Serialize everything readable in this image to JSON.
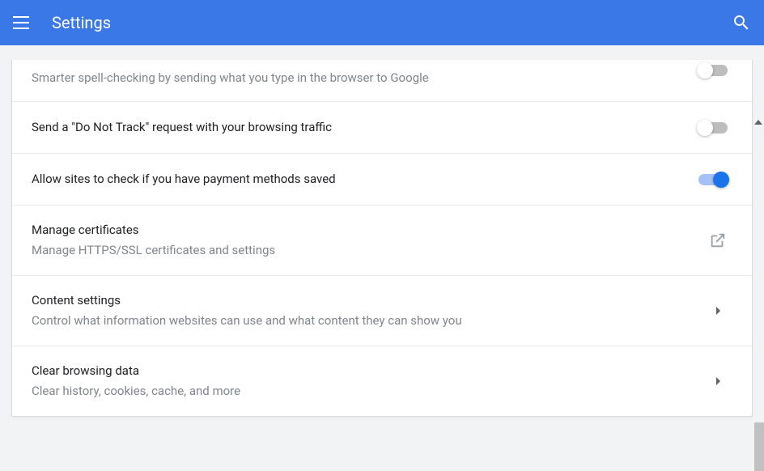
{
  "header": {
    "title": "Settings"
  },
  "settings": {
    "spellcheck": {
      "subtitle": "Smarter spell-checking by sending what you type in the browser to Google",
      "enabled": false
    },
    "dnt": {
      "title": "Send a \"Do Not Track\" request with your browsing traffic",
      "enabled": false
    },
    "payment": {
      "title": "Allow sites to check if you have payment methods saved",
      "enabled": true
    },
    "certificates": {
      "title": "Manage certificates",
      "subtitle": "Manage HTTPS/SSL certificates and settings"
    },
    "content": {
      "title": "Content settings",
      "subtitle": "Control what information websites can use and what content they can show you"
    },
    "clear": {
      "title": "Clear browsing data",
      "subtitle": "Clear history, cookies, cache, and more"
    }
  }
}
